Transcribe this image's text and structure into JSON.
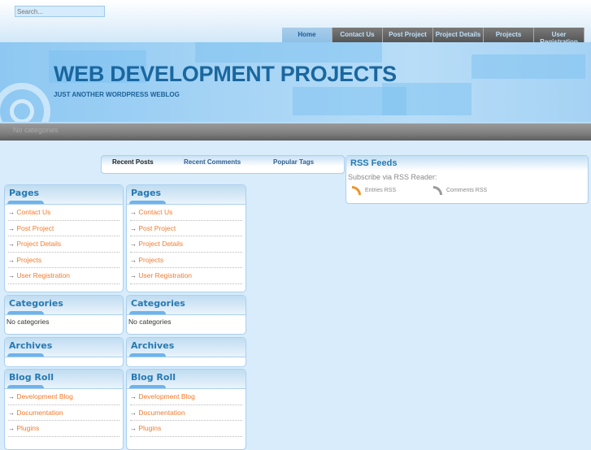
{
  "search": {
    "placeholder": "Search..."
  },
  "nav": [
    "Home",
    "Contact Us",
    "Post Project",
    "Project Details",
    "Projects",
    "User Registration"
  ],
  "site": {
    "title": "WEB DEVELOPMENT PROJECTS",
    "tagline": "JUST ANOTHER WORDPRESS WEBLOG"
  },
  "bar": {
    "text": "No categories"
  },
  "tabs": [
    "Recent Posts",
    "Recent Comments",
    "Popular Tags"
  ],
  "rss": {
    "title": "RSS Feeds",
    "subtitle": "Subscribe via RSS Reader:",
    "entries": "Entries RSS",
    "comments": "Comments RSS",
    "colors": {
      "entries": "#f0932b",
      "comments": "#999999"
    }
  },
  "arrow": "→",
  "widgets": {
    "pages": {
      "title": "Pages",
      "items": [
        "Contact Us",
        "Post Project",
        "Project Details",
        "Projects",
        "User Registration"
      ]
    },
    "categories": {
      "title": "Categories",
      "text": "No categories"
    },
    "archives": {
      "title": "Archives"
    },
    "blogroll": {
      "title": "Blog Roll",
      "items": [
        "Development Blog",
        "Documentation",
        "Plugins"
      ]
    }
  }
}
